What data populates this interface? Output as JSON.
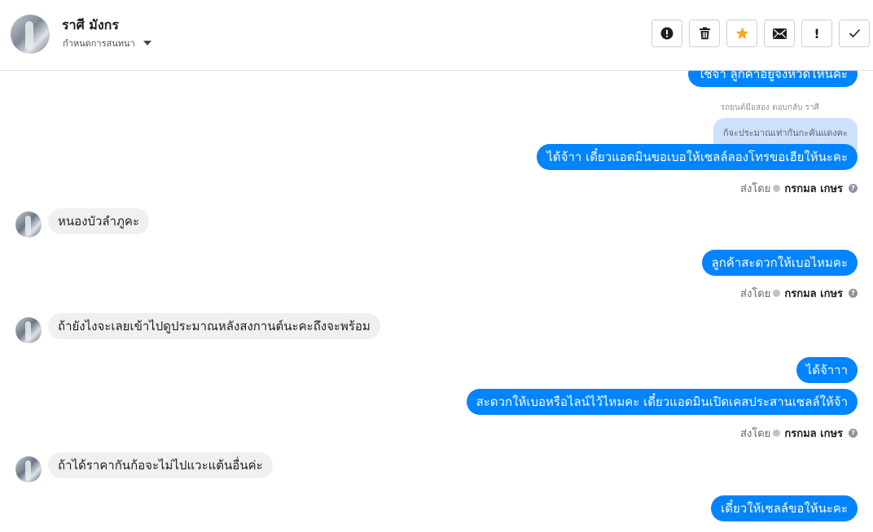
{
  "header": {
    "name": "ราศี มังกร",
    "assign_label": "กำหนดการสนทนา",
    "tools": [
      {
        "name": "report-spam",
        "icon": "exclamation-circle-icon"
      },
      {
        "name": "delete",
        "icon": "trash-icon"
      },
      {
        "name": "star",
        "icon": "star-icon",
        "color": "#f5a623"
      },
      {
        "name": "mark-unread",
        "icon": "envelope-icon"
      },
      {
        "name": "follow-up",
        "icon": "exclamation-icon",
        "label": "!"
      },
      {
        "name": "mark-done",
        "icon": "check-icon"
      }
    ]
  },
  "conversation": {
    "top_partial": "ใช่จ้า ลูกค้าอยู่จังหวัดไหนคะ",
    "reply_label": "รถยนต์มือสอง ตอบกลับ ราศี",
    "reply_context": "ก้จะประมาณเท่ากันกะคันแดงคะ",
    "out_1": "ได้จ้าา เดี๋ยวแอดมินขอเบอให้เซลล์ลองโทรขอเฮียให้นะคะ",
    "sent_by_1": {
      "prefix": "ส่งโดย",
      "who": "กรกมล เกษร"
    },
    "in_1": "หนองบัวลำภูคะ",
    "out_2": "ลูกค้าสะดวกให้เบอไหมคะ",
    "sent_by_2": {
      "prefix": "ส่งโดย",
      "who": "กรกมล เกษร"
    },
    "in_2": "ถ้ายังไงจะเลยเข้าไปดูประมาณหลังสงกานต์นะคะถึงจะพร้อม",
    "out_3a": "ได้จ้าาา",
    "out_3b": "สะดวกให้เบอหรือไลน์ไว้ไหมคะ เดี๋ยวแอดมินเปิดเคสประสานเซลล์ให้จ้า",
    "sent_by_3": {
      "prefix": "ส่งโดย",
      "who": "กรกมล เกษร"
    },
    "in_3": "ถ้าได้ราคากันก้อจะไม่ไปแวะแต้นอื่นค่ะ",
    "out_4": "เดี๋ยวให้เซลล์ขอให้นะคะ"
  },
  "colors": {
    "outgoing": "#0084ff",
    "incoming": "#f1f0f0",
    "reply_context_bg": "#cfe0fb",
    "star": "#f5a623"
  }
}
